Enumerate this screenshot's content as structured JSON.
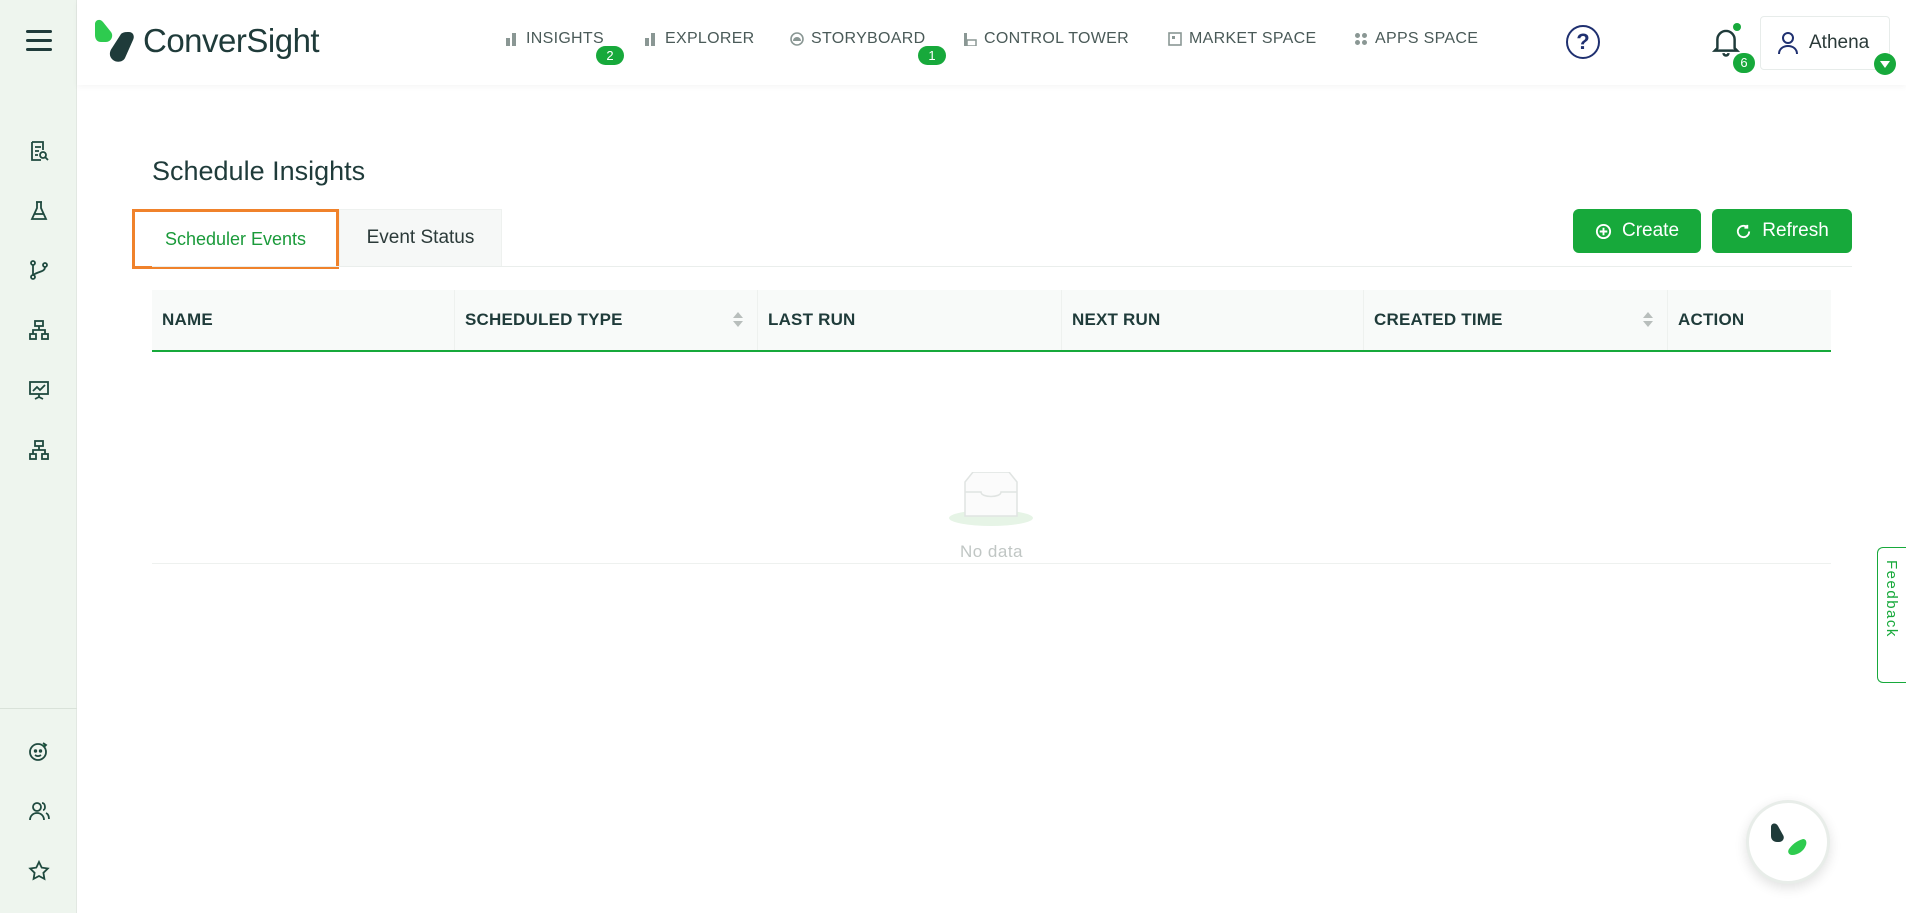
{
  "app": {
    "logo_text": "ConverSight"
  },
  "nav": {
    "items": [
      {
        "label": "INSIGHTS",
        "badge": "2"
      },
      {
        "label": "EXPLORER"
      },
      {
        "label": "STORYBOARD",
        "badge": "1"
      },
      {
        "label": "CONTROL TOWER"
      },
      {
        "label": "MARKET SPACE"
      },
      {
        "label": "APPS SPACE"
      }
    ]
  },
  "header": {
    "help_glyph": "?",
    "notifications_count": "6",
    "user_name": "Athena"
  },
  "page": {
    "title": "Schedule Insights",
    "tabs": [
      {
        "label": "Scheduler Events",
        "active": true
      },
      {
        "label": "Event Status",
        "active": false
      }
    ],
    "create_label": "Create",
    "refresh_label": "Refresh"
  },
  "table": {
    "columns": [
      {
        "label": "NAME",
        "sortable": false
      },
      {
        "label": "SCHEDULED TYPE",
        "sortable": true
      },
      {
        "label": "LAST RUN",
        "sortable": false
      },
      {
        "label": "NEXT RUN",
        "sortable": false
      },
      {
        "label": "CREATED TIME",
        "sortable": true
      },
      {
        "label": "ACTION",
        "sortable": false
      }
    ],
    "rows": [],
    "empty_text": "No data"
  },
  "feedback": {
    "label": "Feedback"
  },
  "colors": {
    "primary": "#17a93b",
    "highlight": "#f0822b",
    "text": "#1f3b3a"
  },
  "sidebar": {
    "icons": [
      "menu-icon",
      "report-search-icon",
      "flask-icon",
      "branch-icon",
      "hierarchy-icon",
      "presentation-chart-icon",
      "hierarchy-icon",
      "bot-icon",
      "users-icon",
      "star-icon"
    ]
  }
}
